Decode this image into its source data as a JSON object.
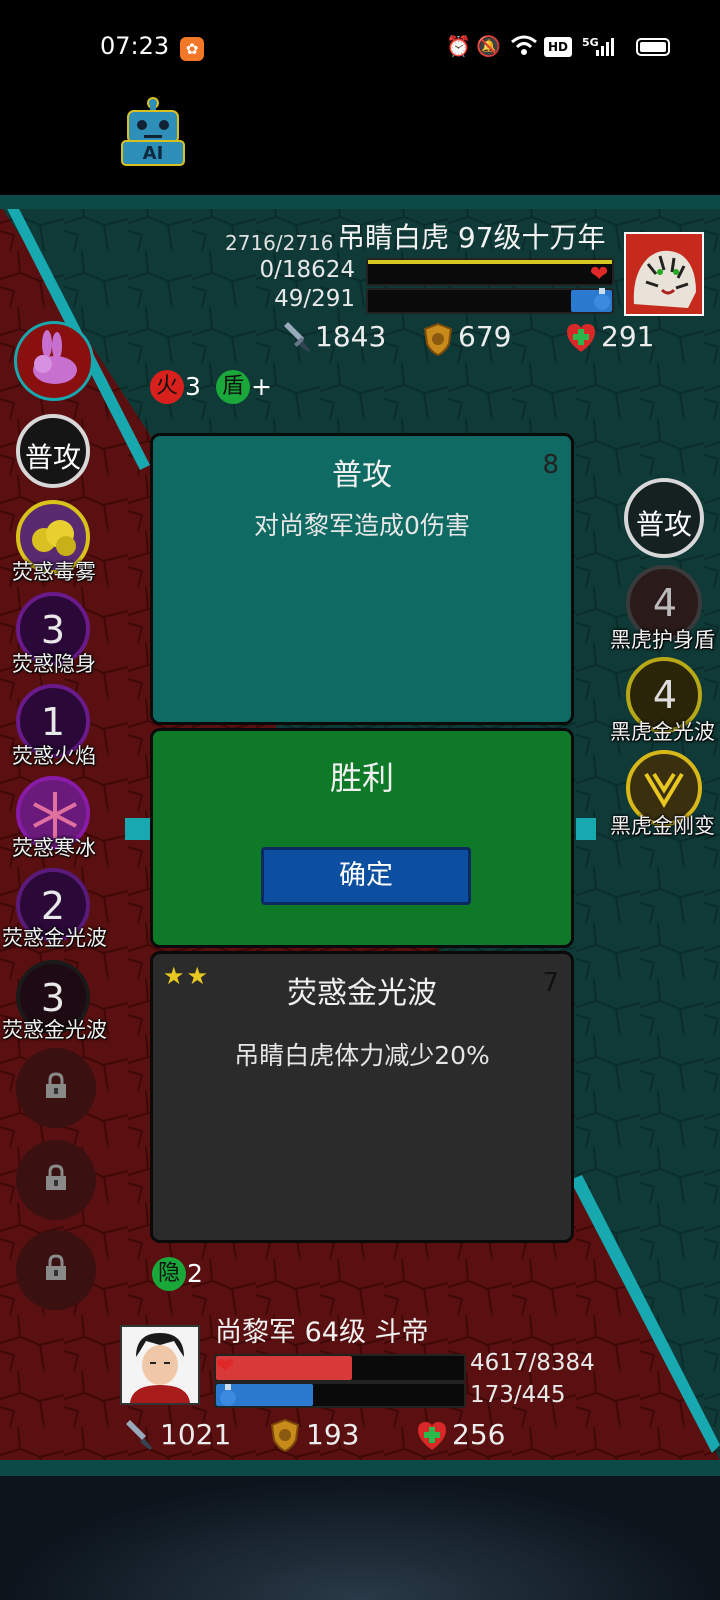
{
  "status_bar": {
    "time": "07:23",
    "app_badge_icon": "app-notification-icon",
    "icons": [
      "alarm-icon",
      "mute-icon",
      "wifi-icon",
      "hd-icon",
      "signal-5g-icon",
      "battery-icon"
    ],
    "hd": "HD",
    "network": "5G"
  },
  "ai_button": {
    "label": "AI",
    "icon": "robot-icon"
  },
  "enemy": {
    "name": "吊睛白虎 97级十万年",
    "hp_text": "2716/2716",
    "rage_text": "0/18624",
    "mp_text": "49/291",
    "hp_ratio": 1.0,
    "rage_ratio": 0.0,
    "mp_ratio": 0.17,
    "attack": "1843",
    "defense": "679",
    "heal": "291",
    "portrait_icon": "white-tiger-icon"
  },
  "enemy_buffs": [
    {
      "glyph": "火",
      "value": "3",
      "color": "#d8201c"
    },
    {
      "glyph": "盾",
      "value": "+",
      "color": "#1aa83a"
    }
  ],
  "player_skills": [
    {
      "label": "普攻",
      "count": "",
      "icon": "normal-attack-icon",
      "ring": "#d8d8d8"
    },
    {
      "label": "荧惑毒雾",
      "count": "",
      "icon": "poison-fog-icon",
      "ring": "#d9c21a"
    },
    {
      "label": "荧惑隐身",
      "count": "3",
      "icon": "stealth-icon",
      "ring": "#6a1a8a"
    },
    {
      "label": "荧惑火焰",
      "count": "1",
      "icon": "flame-icon",
      "ring": "#6a1a8a"
    },
    {
      "label": "荧惑寒冰",
      "count": "",
      "icon": "ice-icon",
      "ring": "#8a1aa8"
    },
    {
      "label": "荧惑金光波",
      "count": "2",
      "icon": "golden-wave-icon",
      "ring": "#5a1a7a"
    },
    {
      "label": "荧惑金光波",
      "count": "3",
      "icon": "golden-wave-icon",
      "ring": "#1a1a1a"
    }
  ],
  "locked_slots": [
    "lock-icon",
    "lock-icon",
    "lock-icon"
  ],
  "enemy_skills": [
    {
      "label": "普攻",
      "count": "",
      "icon": "normal-attack-icon"
    },
    {
      "label": "黑虎护身盾",
      "count": "4",
      "icon": "guard-shield-icon"
    },
    {
      "label": "黑虎金光波",
      "count": "4",
      "icon": "golden-wave-icon"
    },
    {
      "label": "黑虎金刚变",
      "count": "",
      "icon": "diamond-transform-icon"
    }
  ],
  "card_attack": {
    "title": "普攻",
    "number": "8",
    "desc": "对尚黎军造成0伤害"
  },
  "result_dialog": {
    "title": "胜利",
    "confirm_label": "确定"
  },
  "card_skill": {
    "title": "荧惑金光波",
    "number": "7",
    "desc": "吊睛白虎体力减少20%",
    "stars": "★★"
  },
  "player_buff": {
    "glyph": "隐",
    "value": "2",
    "color": "#1aa83a"
  },
  "player": {
    "name": "尚黎军 64级 斗帝",
    "hp_text": "4617/8384",
    "mp_text": "173/445",
    "hp_ratio": 0.55,
    "mp_ratio": 0.39,
    "attack": "1021",
    "defense": "193",
    "heal": "256",
    "portrait_icon": "hero-avatar-icon"
  },
  "colors": {
    "field_teal": "#0f3a38",
    "field_red": "#5a1010",
    "card_teal": "#0e6a62",
    "card_green": "#0e7a28",
    "card_dark": "#2b2b2b",
    "confirm_blue": "#0c4ea0",
    "hp_red": "#d83a3a",
    "mp_blue": "#2a7ad0",
    "rage_yellow": "#d8c820"
  }
}
